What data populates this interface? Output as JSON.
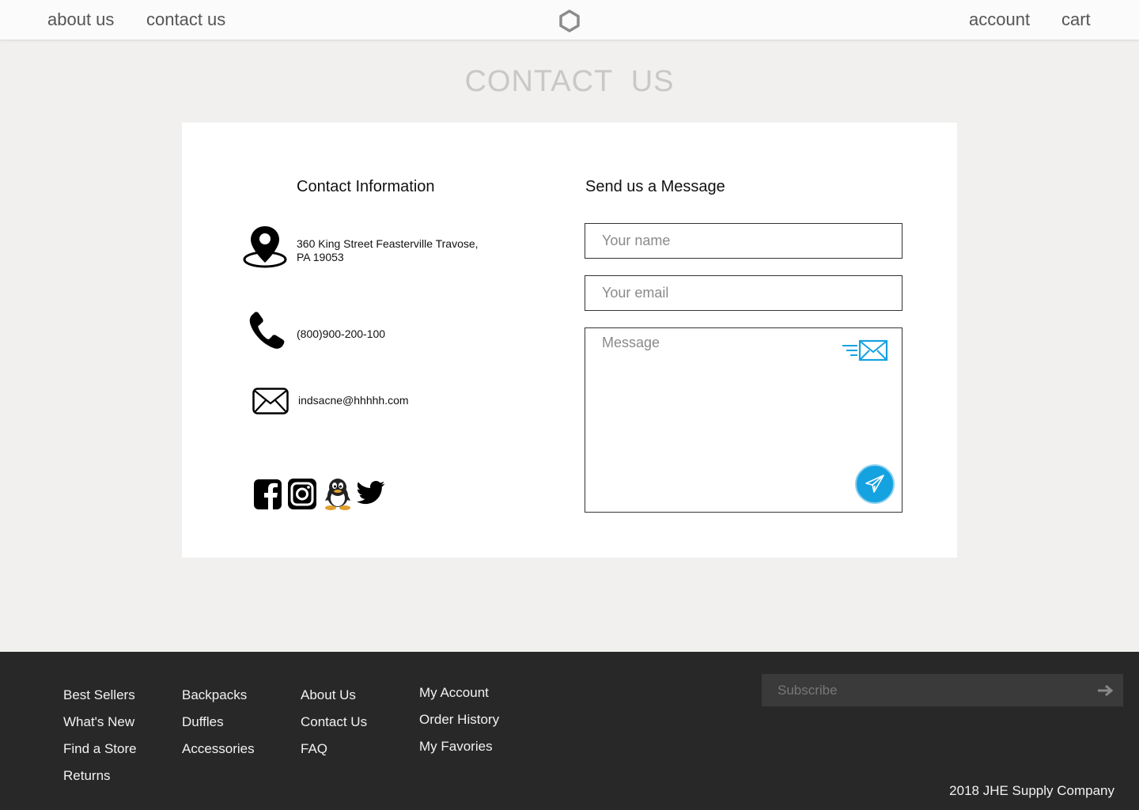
{
  "header": {
    "nav_left": [
      "about us",
      "contact us"
    ],
    "nav_right": [
      "account",
      "cart"
    ],
    "logo_icon": "hexagon-logo-icon"
  },
  "page": {
    "title": "CONTACT  US"
  },
  "contact_info": {
    "heading": "Contact Information",
    "address_line1": "360 King Street Feasterville Travose,",
    "address_line2": "PA 19053",
    "phone": "(800)900-200-100",
    "email": "indsacne@hhhhh.com",
    "icons": {
      "address": "map-pin-icon",
      "phone": "phone-icon",
      "email": "envelope-icon"
    },
    "social": [
      "facebook-icon",
      "instagram-icon",
      "qq-penguin-icon",
      "twitter-icon"
    ]
  },
  "message_form": {
    "heading": "Send us a Message",
    "name_placeholder": "Your name",
    "name_value": "",
    "email_placeholder": "Your email",
    "email_value": "",
    "message_placeholder": "Message",
    "message_value": "",
    "decor_icon": "flying-envelope-icon",
    "send_icon": "paper-plane-icon",
    "accent_color": "#15a2e0"
  },
  "footer": {
    "columns": [
      [
        "Best Sellers",
        "What's New",
        "Find a Store",
        "Returns"
      ],
      [
        "Backpacks",
        "Duffles",
        "Accessories"
      ],
      [
        "About Us",
        "Contact Us",
        "FAQ"
      ],
      [
        "My Account",
        "Order History",
        "My Favories"
      ]
    ],
    "subscribe_placeholder": "Subscribe",
    "subscribe_value": "",
    "subscribe_icon": "arrow-right-icon",
    "copyright": "2018 JHE Supply Company",
    "background": "#282828"
  }
}
